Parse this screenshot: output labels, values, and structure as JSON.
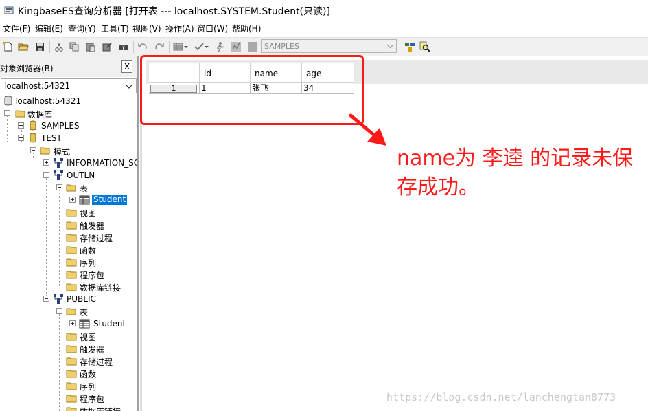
{
  "window": {
    "title": "KingbaseES查询分析器 [打开表  ---  localhost.SYSTEM.Student(只读)]"
  },
  "menu": [
    "文件(F)",
    "编辑(E)",
    "查询(Y)",
    "工具(T)",
    "视图(V)",
    "操作(A)",
    "窗口(W)",
    "帮助(H)"
  ],
  "toolbar": {
    "database_combo": "SAMPLES"
  },
  "object_browser": {
    "title": "对象浏览器(B)",
    "close_label": "X",
    "connection": "localhost:54321",
    "tree": [
      "localhost:54321",
      "数据库",
      "SAMPLES",
      "TEST",
      "模式",
      "INFORMATION_SC",
      "OUTLN",
      "表",
      "Student",
      "视图",
      "触发器",
      "存储过程",
      "函数",
      "序列",
      "程序包",
      "数据库链接",
      "PUBLIC",
      "表",
      "Student",
      "视图",
      "触发器",
      "存储过程",
      "函数",
      "序列",
      "程序包",
      "数据库链接"
    ]
  },
  "grid": {
    "columns": [
      "id",
      "name",
      "age"
    ],
    "rows": [
      {
        "row_no": "1",
        "cells": [
          "1",
          "张飞",
          "34"
        ]
      }
    ]
  },
  "annotation": {
    "text": "name为 李逵 的记录未保存成功。",
    "color": "#ff1a1a"
  },
  "watermark": "https://blog.csdn.net/lanchengtan8773"
}
